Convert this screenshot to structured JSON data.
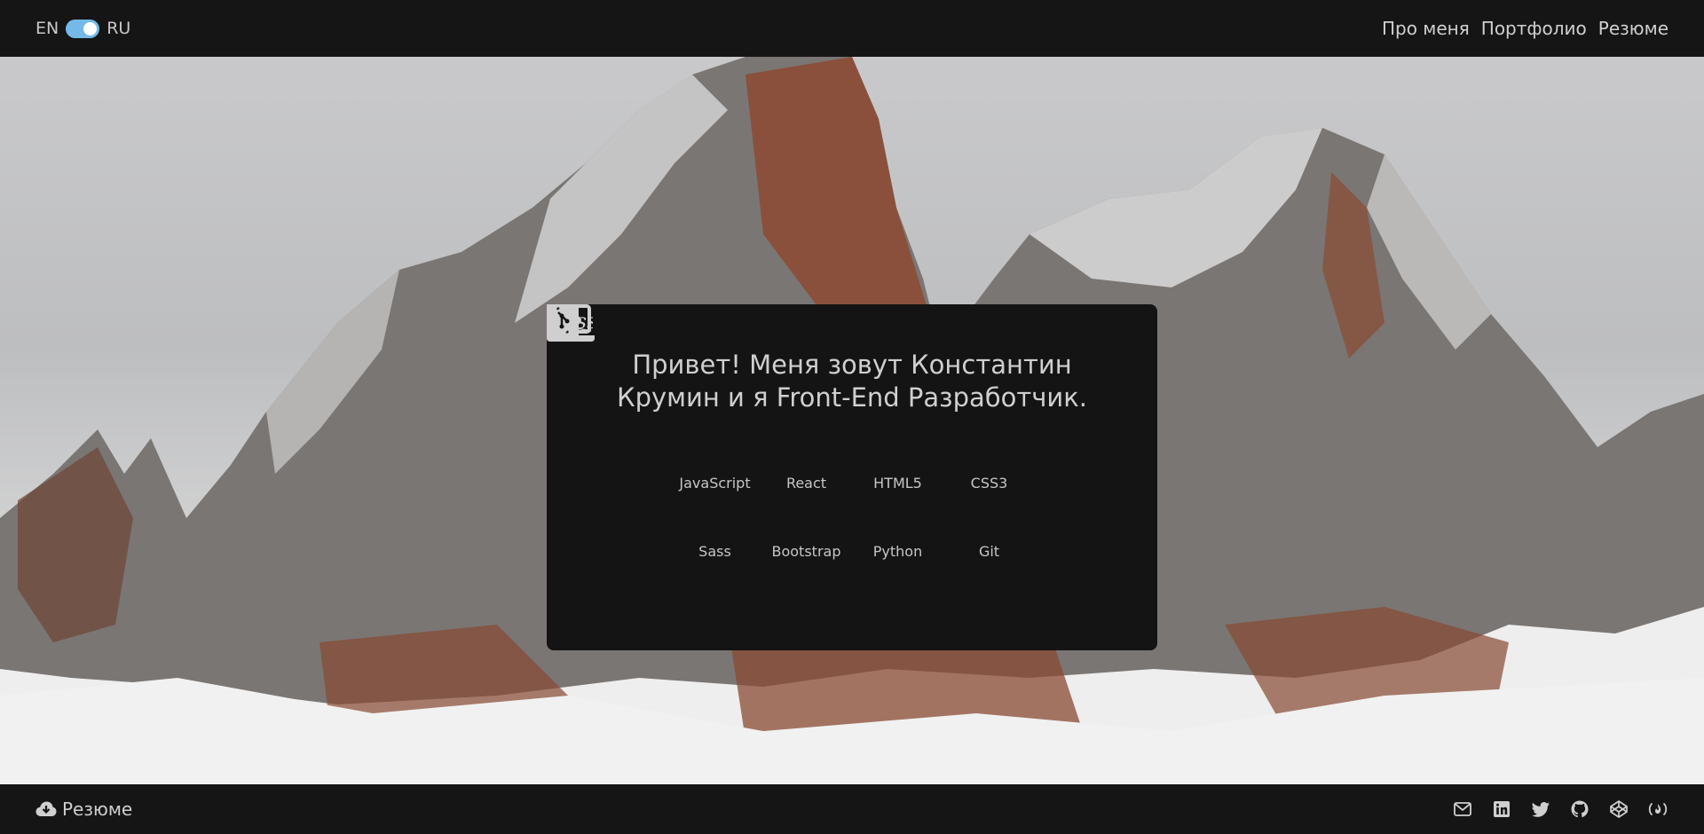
{
  "header": {
    "lang_left": "EN",
    "lang_right": "RU",
    "toggle_on": true,
    "nav": [
      {
        "label": "Про меня"
      },
      {
        "label": "Портфолио"
      },
      {
        "label": "Резюме"
      }
    ]
  },
  "hero": {
    "greeting": "Привет! Меня зовут Константин Крумин и я Front-End Разработчик.",
    "skills": [
      {
        "label": "JavaScript",
        "icon": "javascript-icon"
      },
      {
        "label": "React",
        "icon": "react-icon"
      },
      {
        "label": "HTML5",
        "icon": "html5-icon"
      },
      {
        "label": "CSS3",
        "icon": "css3-icon"
      },
      {
        "label": "Sass",
        "icon": "sass-icon"
      },
      {
        "label": "Bootstrap",
        "icon": "bootstrap-icon"
      },
      {
        "label": "Python",
        "icon": "python-icon"
      },
      {
        "label": "Git",
        "icon": "git-icon"
      }
    ]
  },
  "footer": {
    "resume_label": "Резюме",
    "socials": [
      "mail-icon",
      "linkedin-icon",
      "twitter-icon",
      "github-icon",
      "codepen-icon",
      "freecodecamp-icon"
    ]
  },
  "colors": {
    "bar": "#151515",
    "card": "#141414",
    "toggle": "#74b9e8",
    "text": "#d0d0d0"
  }
}
